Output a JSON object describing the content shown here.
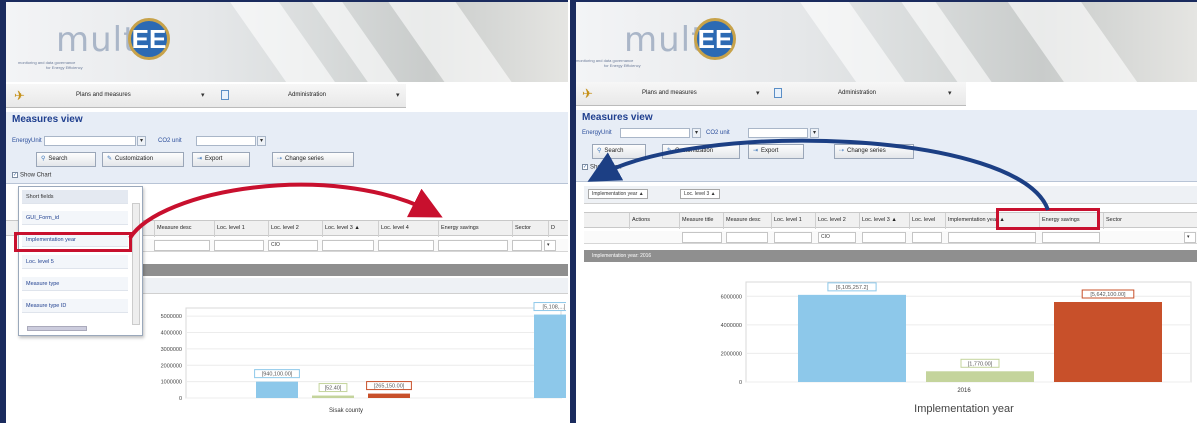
{
  "app": {
    "logo": "multEE",
    "tagline": [
      "monitoring and data governance",
      "for Energy Efficiency"
    ]
  },
  "menu": {
    "item1": "Plans and measures",
    "item2": "Administration"
  },
  "view": {
    "title": "Measures view",
    "energy_unit_label": "EnergyUnit",
    "co2_unit_label": "CO2 unit",
    "buttons": {
      "search": "Search",
      "customization": "Customization",
      "export": "Export",
      "change_series": "Change series"
    },
    "show_chart_label": "Show Chart"
  },
  "left": {
    "dropdown": {
      "header": "Short fields",
      "items": [
        "GUI_Form_id",
        "Implementation year",
        "Loc. level 5",
        "Measure type",
        "Measure type ID"
      ]
    },
    "columns": [
      "e",
      "Measure desc",
      "Loc. level 1",
      "Loc. level 2",
      "Loc. level 3 ▲",
      "Loc. level 4",
      "Energy savings",
      "Sector",
      "D"
    ],
    "filter_value": "CIO",
    "chart_data": {
      "type": "bar",
      "categories": [
        "Sisak county"
      ],
      "series": [
        {
          "values": [
            1000000
          ],
          "label": "[940,100.00]"
        },
        {
          "values": [
            150000
          ],
          "label": "[52.40]"
        },
        {
          "values": [
            270000
          ],
          "label": "[265,150.00]"
        },
        {
          "values": [
            5100000
          ],
          "label": "[5,108,...]"
        }
      ],
      "yticks": [
        "5000000",
        "4000000",
        "3000000",
        "2000000",
        "1000000",
        "0"
      ],
      "ylim": [
        0,
        5500000
      ],
      "colors": [
        "#8dc8ea",
        "#c4d49c",
        "#c8502a",
        "#8dc8ea"
      ]
    }
  },
  "right": {
    "group_chips": [
      "Implementation year ▲",
      "Loc. level 3 ▲"
    ],
    "columns": [
      "Actions",
      "Measure title",
      "Measure desc",
      "Loc. level 1",
      "Loc. level 2",
      "Loc. level 3 ▲",
      "Loc. level",
      "Implementation year ▲",
      "Energy savings",
      "Sector"
    ],
    "filter_value": "CIO",
    "group_row": "Implementation year: 2016",
    "chart_data": {
      "type": "bar",
      "categories": [
        "2016"
      ],
      "series": [
        {
          "values": [
            6100000
          ],
          "label": "[6,105,257.2]"
        },
        {
          "values": [
            750000
          ],
          "label": "[1,770.00]"
        },
        {
          "values": [
            5600000
          ],
          "label": "[5,642,100.00]"
        }
      ],
      "xlabel": "Implementation year",
      "yticks": [
        "6000000",
        "4000000",
        "2000000",
        "0"
      ],
      "ylim": [
        0,
        7000000
      ],
      "colors": [
        "#8dc8ea",
        "#c4d49c",
        "#c8502a"
      ]
    }
  }
}
